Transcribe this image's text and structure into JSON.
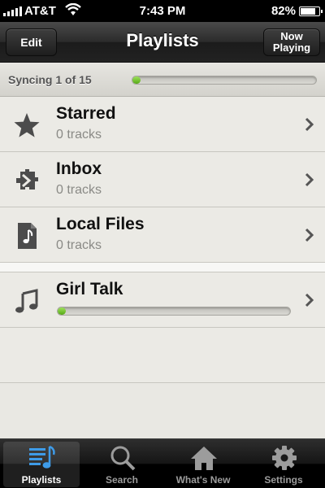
{
  "status_bar": {
    "carrier": "AT&T",
    "time": "7:43 PM",
    "battery": "82%",
    "battery_level": 0.82
  },
  "nav": {
    "edit_label": "Edit",
    "title": "Playlists",
    "now_playing_label": "Now\nPlaying"
  },
  "sync": {
    "text": "Syncing 1 of 15",
    "progress": 0.03
  },
  "playlists": [
    {
      "title": "Starred",
      "subtitle": "0 tracks",
      "icon": "star-icon"
    },
    {
      "title": "Inbox",
      "subtitle": "0 tracks",
      "icon": "inbox-puzzle-icon"
    },
    {
      "title": "Local Files",
      "subtitle": "0 tracks",
      "icon": "file-music-icon"
    }
  ],
  "user_playlists": [
    {
      "title": "Girl Talk",
      "icon": "music-note-icon",
      "progress": 0.03
    }
  ],
  "tabs": [
    {
      "label": "Playlists",
      "icon": "playlist-icon",
      "active": true
    },
    {
      "label": "Search",
      "icon": "search-icon",
      "active": false
    },
    {
      "label": "What's New",
      "icon": "home-icon",
      "active": false
    },
    {
      "label": "Settings",
      "icon": "gear-icon",
      "active": false
    }
  ],
  "colors": {
    "accent_green": "#6cc12a",
    "active_tab_icon": "#3e9be8"
  }
}
